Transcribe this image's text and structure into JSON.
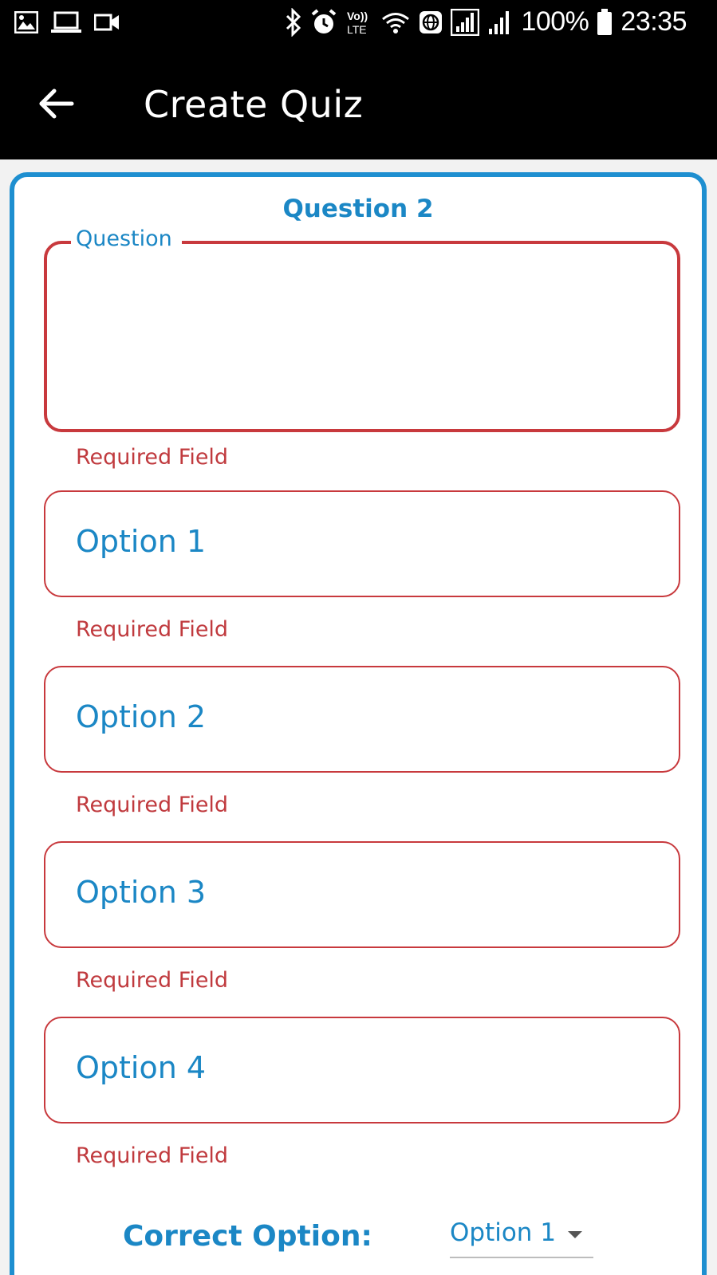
{
  "status_bar": {
    "battery": "100%",
    "time": "23:35",
    "icons": [
      "gallery-icon",
      "laptop-icon",
      "video-icon",
      "bluetooth-icon",
      "alarm-icon",
      "volte-icon",
      "wifi-icon",
      "vpn-icon",
      "signal-icon",
      "signal-icon-2",
      "battery-icon"
    ],
    "volte_label": "Vo))\nLTE"
  },
  "app_bar": {
    "title": "Create Quiz",
    "back_icon": "arrow-left-icon"
  },
  "form": {
    "heading": "Question 2",
    "question": {
      "label": "Question",
      "value": "",
      "error": "Required Field"
    },
    "options": [
      {
        "placeholder": "Option 1",
        "error": "Required Field"
      },
      {
        "placeholder": "Option 2",
        "error": "Required Field"
      },
      {
        "placeholder": "Option 3",
        "error": "Required Field"
      },
      {
        "placeholder": "Option 4",
        "error": "Required Field"
      }
    ],
    "correct_option": {
      "label": "Correct Option:",
      "selected": "Option 1"
    }
  },
  "colors": {
    "accent_blue": "#1b87c5",
    "card_border": "#1e8fd0",
    "error_red": "#c8393d",
    "app_bar": "#000000"
  }
}
